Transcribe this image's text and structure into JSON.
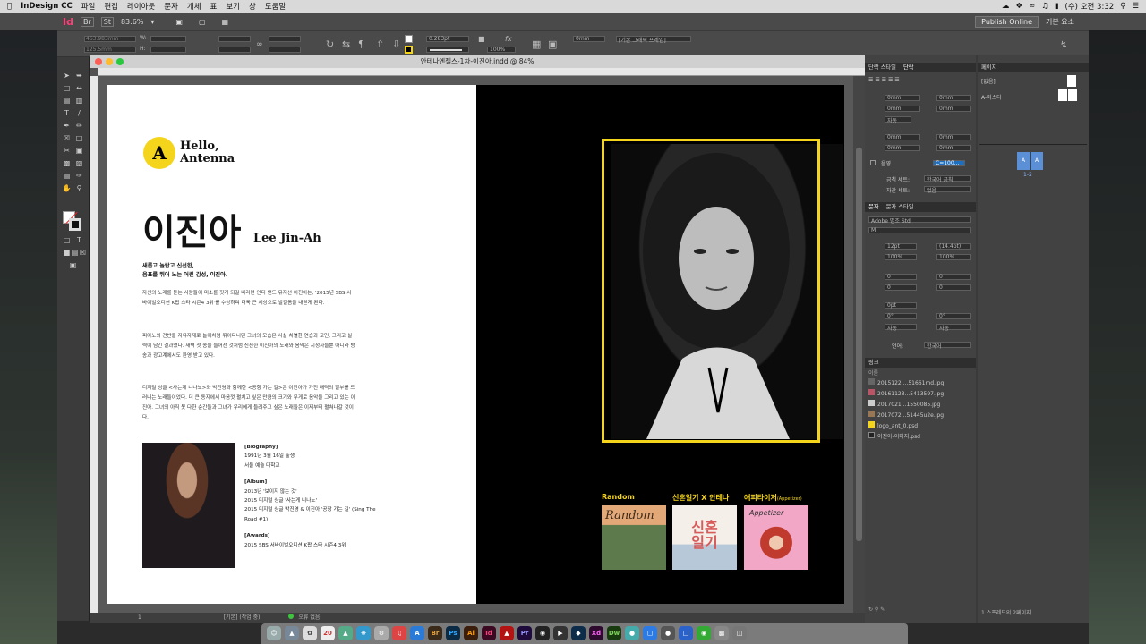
{
  "menubar": {
    "app_name": "InDesign CC",
    "items": [
      "파일",
      "편집",
      "레이아웃",
      "문자",
      "개체",
      "표",
      "보기",
      "창",
      "도움말"
    ],
    "clock": "(수) 오전 3:32"
  },
  "appbar": {
    "zoom": "83.6%",
    "publish_label": "Publish Online",
    "workspace": "기본 요소"
  },
  "control": {
    "x_field": "463.983mm",
    "y_field": "125.5mm",
    "w_label": "W:",
    "h_label": "H:",
    "stroke_weight": "0.283pt",
    "opacity": "100%",
    "offset": "0mm",
    "object_style": "[기본 그래픽 프레임]"
  },
  "document": {
    "title": "안테나엔젤스-1차-이진아.indd @ 84%",
    "page_field": "1",
    "style_field": "[기본] (작업 중)",
    "errors_label": "오류 없음"
  },
  "left_page": {
    "logo_letter": "A",
    "brand_line1": "Hello,",
    "brand_line2": "Antenna",
    "name_kr": "이진아",
    "name_en": "Lee Jin-Ah",
    "lead_line1": "새롭고 놀랍고 신선한,",
    "lead_line2": "음표를 뛰어 노는 어린 감성, 이진아.",
    "para1": "자신의 노래를 듣는 사람들이 미소를 짓게 되길 바라던 인디 밴드 뮤지션 이진아는, '2015년 SBS 서바이벌오디션 K팝 스타 시즌4 3위'를 수상하며 더욱 큰 세상으로 발걸음을 내딛게 된다.",
    "para2": "피아노의 건반을 자유자재로 놀이처럼 뛰어다니던 그녀의 모습은 사실 치열한 연습과 고민, 그리고 실력이 담긴 결과였다. 새벽 첫 송을 들어선 것처럼 신선한 이진아의 노래와 음악은 시청자들뿐 아니라 방송과 광고계에서도 환영 받고 있다.",
    "para3": "디지털 싱글 <사는게 니나노>와 박진영과 함께한 <공항 가는 길>은 이진아가 가진 매력의 일부를 드러내는 노래들이었다. 더 큰 동지에서 마음껏 펼치고 싶은 만큼의 크기와 무게로 음악을 그리고 있는 이진아. 그녀의 아직 못 다한 순간들과 그녀가 우리에게 들려주고 싶은 노래들은 이제부터 펼쳐나갈 것이다.",
    "bio_head": "[Biography]",
    "bio1": "1991년 3월 16일 출생",
    "bio2": "서울 예술 대학교",
    "album_head": "[Album]",
    "album1": "2013년 '보이지 않는 것'",
    "album2": "2015 디지털 싱글 '사는게 니나노'",
    "album3": "2015 디지털 싱글 박진영 & 이진아 '공항 가는 길' (Sing The Road #1)",
    "awards_head": "[Awards]",
    "awards1": "2015 SBS 서바이벌오디션 K팝 스타 시즌4 3위"
  },
  "right_page": {
    "album_titles": [
      "Random",
      "신혼일기 X 안테나",
      "애피타이저"
    ],
    "album3_sub": "(Appetizer)",
    "album1_art": "Random",
    "album2_art": "신혼 일기",
    "album3_art": "Appetizer"
  },
  "panels": {
    "para_tabs": [
      "단락 스타일",
      "단락"
    ],
    "pages_tab": "페이지",
    "pages_none": "[없음]",
    "pages_master": "A-마스터",
    "page_spread": "1-2",
    "page_letter": "A",
    "zero_mm": "0mm",
    "auto_label": "자동",
    "shade_label": "음영",
    "shade_value": "C=100...",
    "jp_label": "금칙 세트:",
    "jp_value": "한국어 금칙",
    "spacing_label": "자간 세트:",
    "spacing_value": "없음",
    "char_tabs": [
      "문자",
      "문자 스타일"
    ],
    "font": "Adobe 명조 Std",
    "weight": "M",
    "size": "12pt",
    "leading": "(14.4pt)",
    "scale": "100%",
    "tracking": "0",
    "zero_pt": "0pt",
    "skew": "0°",
    "language_label": "언어:",
    "language": "한국어",
    "links_tab": "링크",
    "links_header": "이름",
    "links": [
      "2015122....51661md.jpg",
      "20161123...5413597.jpg",
      "2017021...1550085.jpg",
      "2017072...51445u2e.jpg",
      "logo_ant_0.psd",
      "이진아-이미지.psd"
    ],
    "links_footer": "1 스프레드의 2페이지"
  },
  "dock": {
    "icons": [
      {
        "label": "Br",
        "color": "#3a2a1a"
      },
      {
        "label": "Ps",
        "color": "#0b2a44"
      },
      {
        "label": "Ai",
        "color": "#3a1d0a"
      },
      {
        "label": "Id",
        "color": "#3b0a22"
      },
      {
        "label": "Pr",
        "color": "#1e0a3b"
      },
      {
        "label": "Dw",
        "color": "#173a0f"
      },
      {
        "label": "Xd",
        "color": "#2e0a2e"
      }
    ]
  }
}
